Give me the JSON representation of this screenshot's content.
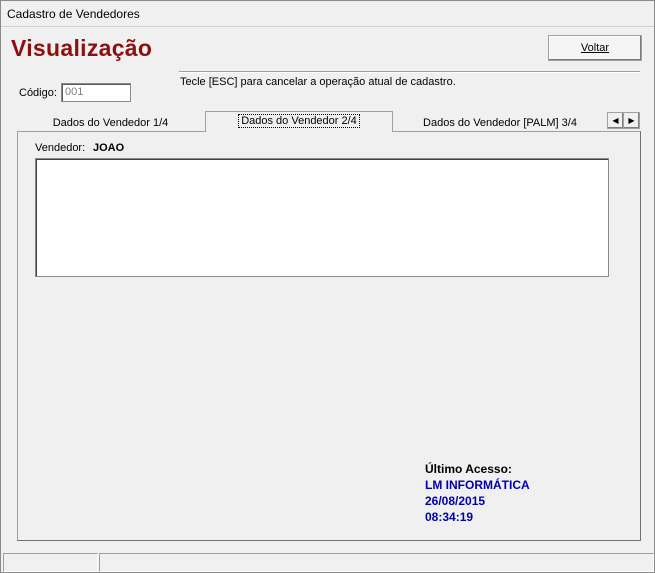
{
  "window": {
    "title": "Cadastro de Vendedores"
  },
  "header": {
    "heading": "Visualização",
    "back_button": "Voltar",
    "hint": "Tecle [ESC] para cancelar a operação atual de cadastro."
  },
  "form": {
    "codigo_label": "Código:",
    "codigo_value": "001"
  },
  "tabs": [
    {
      "label": "Dados do Vendedor 1/4",
      "active": false
    },
    {
      "label": "Dados do Vendedor 2/4",
      "active": true
    },
    {
      "label": "Dados do Vendedor [PALM]  3/4",
      "active": false
    }
  ],
  "tab_nav": {
    "prev_icon": "arrow-left-icon",
    "next_icon": "arrow-right-icon",
    "prev_glyph": "◀",
    "next_glyph": "▶"
  },
  "panel": {
    "vendedor_label": "Vendedor:",
    "vendedor_value": "JOAO",
    "memo_text": ""
  },
  "access": {
    "title": "Último Acesso:",
    "company": "LM INFORMÁTICA",
    "date": "26/08/2015",
    "time": "08:34:19"
  },
  "colors": {
    "heading": "#8b1010",
    "access_values": "#0000aa",
    "background": "#f0f0f0"
  },
  "statusbar": {
    "panel1": "",
    "panel2": ""
  }
}
